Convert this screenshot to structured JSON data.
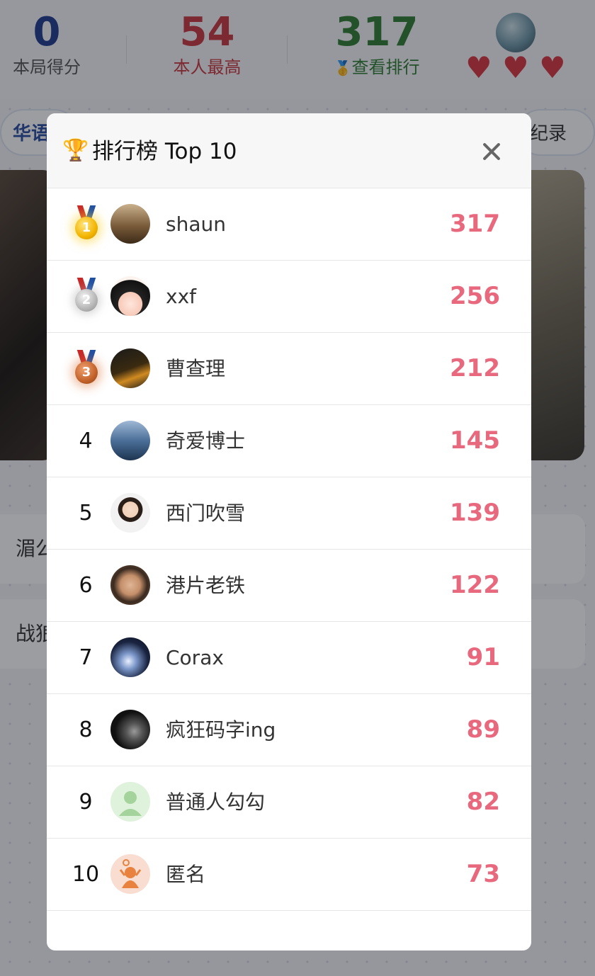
{
  "stats": {
    "current_score": "0",
    "current_score_label": "本局得分",
    "personal_best": "54",
    "personal_best_label": "本人最高",
    "leaderboard_top": "317",
    "leaderboard_medal": "🥇",
    "leaderboard_label": "查看排行",
    "lives": "3"
  },
  "background": {
    "category_pill": "华语",
    "records_pill": "纪录",
    "option_1": "湄公",
    "option_2": "战狼"
  },
  "modal": {
    "trophy_icon": "🏆",
    "title": "排行榜 Top 10",
    "rows": [
      {
        "rank": "1",
        "medal": "gold",
        "name": "shaun",
        "score": "317"
      },
      {
        "rank": "2",
        "medal": "silver",
        "name": "xxf",
        "score": "256"
      },
      {
        "rank": "3",
        "medal": "bronze",
        "name": "曹查理",
        "score": "212"
      },
      {
        "rank": "4",
        "name": "奇爱博士",
        "score": "145"
      },
      {
        "rank": "5",
        "name": "西门吹雪",
        "score": "139"
      },
      {
        "rank": "6",
        "name": "港片老铁",
        "score": "122"
      },
      {
        "rank": "7",
        "name": "Corax",
        "score": "91"
      },
      {
        "rank": "8",
        "name": "疯狂码字ing",
        "score": "89"
      },
      {
        "rank": "9",
        "name": "普通人勾勾",
        "score": "82"
      },
      {
        "rank": "10",
        "name": "匿名",
        "score": "73"
      }
    ]
  },
  "colors": {
    "score_pink": "#e8697d",
    "best_red": "#c9373e",
    "rank_green": "#2e7d32",
    "score_blue": "#1f3b8f"
  }
}
